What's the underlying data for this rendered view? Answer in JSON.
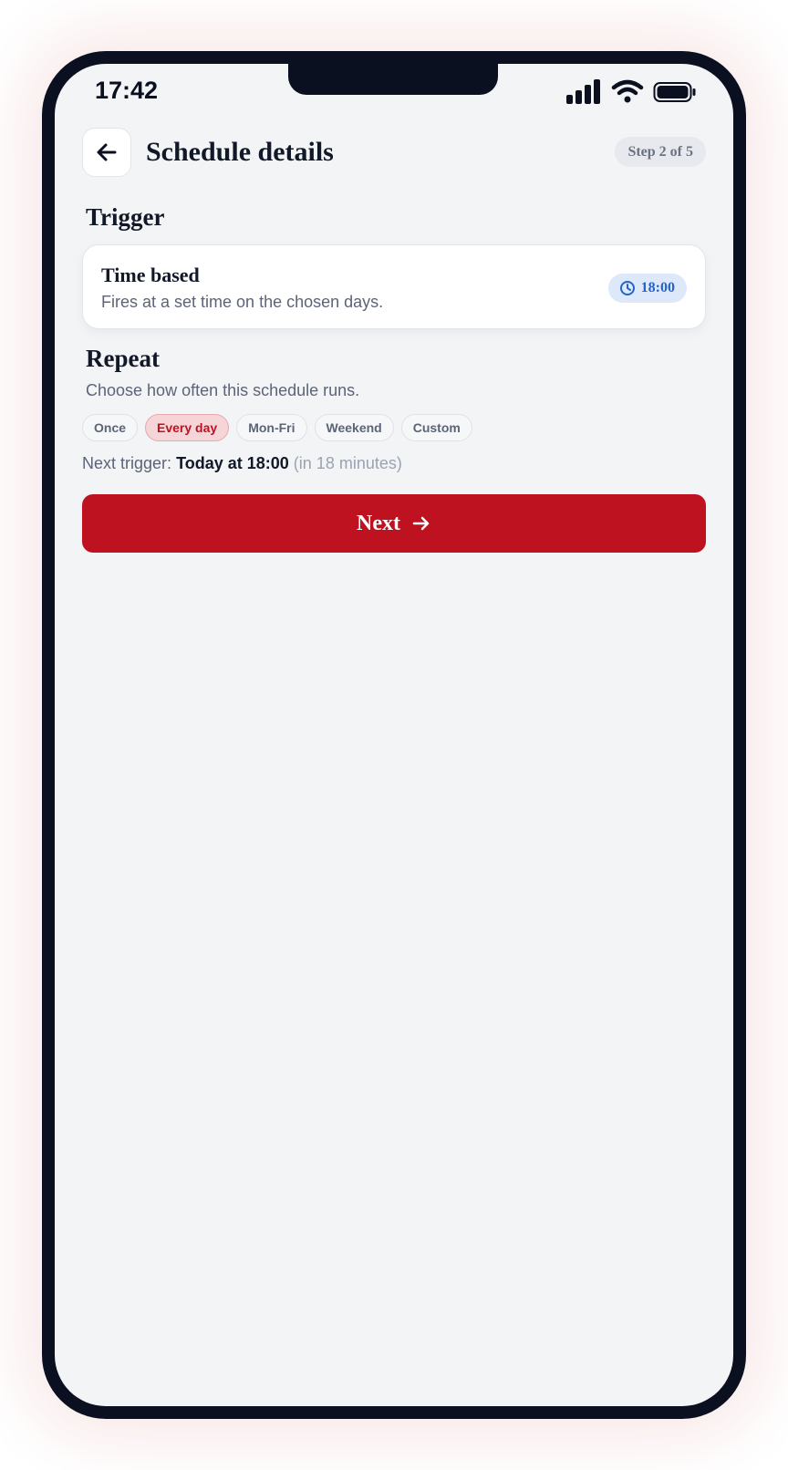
{
  "status_bar": {
    "time": "17:42",
    "icons": [
      "signal-icon",
      "wifi-icon",
      "battery-icon"
    ]
  },
  "header": {
    "back_icon": "arrow-left-icon",
    "title": "Schedule details",
    "step_badge": "Step 2 of 5"
  },
  "trigger": {
    "heading": "Trigger",
    "card_title": "Time based",
    "card_description": "Fires at a set time on the chosen days.",
    "time_value": "18:00",
    "time_icon": "clock-icon"
  },
  "repeat": {
    "heading": "Repeat",
    "description": "Choose how often this schedule runs.",
    "options": [
      "Once",
      "Every day",
      "Mon-Fri",
      "Weekend",
      "Custom"
    ],
    "selected": "Every day"
  },
  "next_trigger": {
    "prefix": "Next trigger:",
    "value": "Today at 18:00",
    "relative": "(in 18 minutes)"
  },
  "next_button": {
    "label": "Next",
    "icon": "arrow-right-icon"
  },
  "colors": {
    "accent": "#be1220",
    "accent_soft": "#f6d5d8",
    "time_pill_bg": "#dde8fb",
    "time_pill_text": "#2563c9",
    "screen_bg": "#f3f4f6",
    "frame": "#0b1020"
  }
}
